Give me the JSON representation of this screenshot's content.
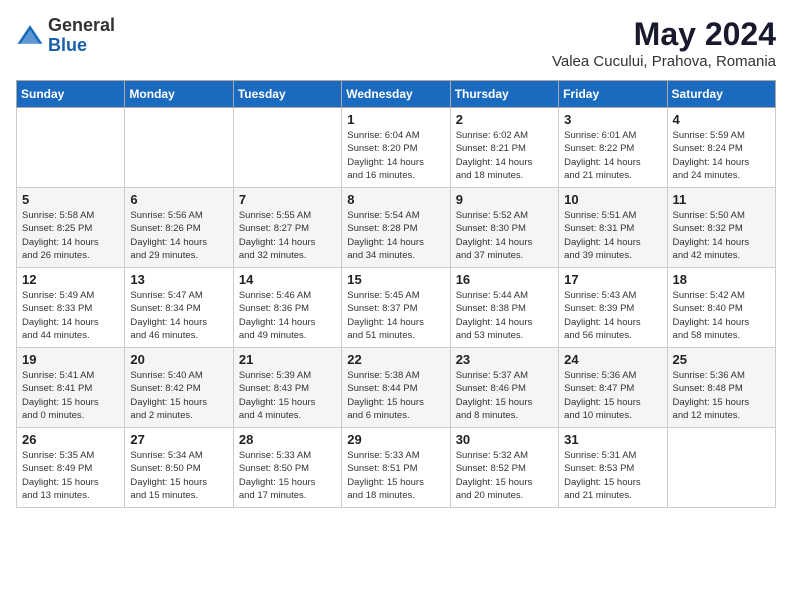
{
  "logo": {
    "general": "General",
    "blue": "Blue"
  },
  "title": "May 2024",
  "location": "Valea Cucului, Prahova, Romania",
  "days_of_week": [
    "Sunday",
    "Monday",
    "Tuesday",
    "Wednesday",
    "Thursday",
    "Friday",
    "Saturday"
  ],
  "weeks": [
    [
      {
        "day": "",
        "info": ""
      },
      {
        "day": "",
        "info": ""
      },
      {
        "day": "",
        "info": ""
      },
      {
        "day": "1",
        "info": "Sunrise: 6:04 AM\nSunset: 8:20 PM\nDaylight: 14 hours\nand 16 minutes."
      },
      {
        "day": "2",
        "info": "Sunrise: 6:02 AM\nSunset: 8:21 PM\nDaylight: 14 hours\nand 18 minutes."
      },
      {
        "day": "3",
        "info": "Sunrise: 6:01 AM\nSunset: 8:22 PM\nDaylight: 14 hours\nand 21 minutes."
      },
      {
        "day": "4",
        "info": "Sunrise: 5:59 AM\nSunset: 8:24 PM\nDaylight: 14 hours\nand 24 minutes."
      }
    ],
    [
      {
        "day": "5",
        "info": "Sunrise: 5:58 AM\nSunset: 8:25 PM\nDaylight: 14 hours\nand 26 minutes."
      },
      {
        "day": "6",
        "info": "Sunrise: 5:56 AM\nSunset: 8:26 PM\nDaylight: 14 hours\nand 29 minutes."
      },
      {
        "day": "7",
        "info": "Sunrise: 5:55 AM\nSunset: 8:27 PM\nDaylight: 14 hours\nand 32 minutes."
      },
      {
        "day": "8",
        "info": "Sunrise: 5:54 AM\nSunset: 8:28 PM\nDaylight: 14 hours\nand 34 minutes."
      },
      {
        "day": "9",
        "info": "Sunrise: 5:52 AM\nSunset: 8:30 PM\nDaylight: 14 hours\nand 37 minutes."
      },
      {
        "day": "10",
        "info": "Sunrise: 5:51 AM\nSunset: 8:31 PM\nDaylight: 14 hours\nand 39 minutes."
      },
      {
        "day": "11",
        "info": "Sunrise: 5:50 AM\nSunset: 8:32 PM\nDaylight: 14 hours\nand 42 minutes."
      }
    ],
    [
      {
        "day": "12",
        "info": "Sunrise: 5:49 AM\nSunset: 8:33 PM\nDaylight: 14 hours\nand 44 minutes."
      },
      {
        "day": "13",
        "info": "Sunrise: 5:47 AM\nSunset: 8:34 PM\nDaylight: 14 hours\nand 46 minutes."
      },
      {
        "day": "14",
        "info": "Sunrise: 5:46 AM\nSunset: 8:36 PM\nDaylight: 14 hours\nand 49 minutes."
      },
      {
        "day": "15",
        "info": "Sunrise: 5:45 AM\nSunset: 8:37 PM\nDaylight: 14 hours\nand 51 minutes."
      },
      {
        "day": "16",
        "info": "Sunrise: 5:44 AM\nSunset: 8:38 PM\nDaylight: 14 hours\nand 53 minutes."
      },
      {
        "day": "17",
        "info": "Sunrise: 5:43 AM\nSunset: 8:39 PM\nDaylight: 14 hours\nand 56 minutes."
      },
      {
        "day": "18",
        "info": "Sunrise: 5:42 AM\nSunset: 8:40 PM\nDaylight: 14 hours\nand 58 minutes."
      }
    ],
    [
      {
        "day": "19",
        "info": "Sunrise: 5:41 AM\nSunset: 8:41 PM\nDaylight: 15 hours\nand 0 minutes."
      },
      {
        "day": "20",
        "info": "Sunrise: 5:40 AM\nSunset: 8:42 PM\nDaylight: 15 hours\nand 2 minutes."
      },
      {
        "day": "21",
        "info": "Sunrise: 5:39 AM\nSunset: 8:43 PM\nDaylight: 15 hours\nand 4 minutes."
      },
      {
        "day": "22",
        "info": "Sunrise: 5:38 AM\nSunset: 8:44 PM\nDaylight: 15 hours\nand 6 minutes."
      },
      {
        "day": "23",
        "info": "Sunrise: 5:37 AM\nSunset: 8:46 PM\nDaylight: 15 hours\nand 8 minutes."
      },
      {
        "day": "24",
        "info": "Sunrise: 5:36 AM\nSunset: 8:47 PM\nDaylight: 15 hours\nand 10 minutes."
      },
      {
        "day": "25",
        "info": "Sunrise: 5:36 AM\nSunset: 8:48 PM\nDaylight: 15 hours\nand 12 minutes."
      }
    ],
    [
      {
        "day": "26",
        "info": "Sunrise: 5:35 AM\nSunset: 8:49 PM\nDaylight: 15 hours\nand 13 minutes."
      },
      {
        "day": "27",
        "info": "Sunrise: 5:34 AM\nSunset: 8:50 PM\nDaylight: 15 hours\nand 15 minutes."
      },
      {
        "day": "28",
        "info": "Sunrise: 5:33 AM\nSunset: 8:50 PM\nDaylight: 15 hours\nand 17 minutes."
      },
      {
        "day": "29",
        "info": "Sunrise: 5:33 AM\nSunset: 8:51 PM\nDaylight: 15 hours\nand 18 minutes."
      },
      {
        "day": "30",
        "info": "Sunrise: 5:32 AM\nSunset: 8:52 PM\nDaylight: 15 hours\nand 20 minutes."
      },
      {
        "day": "31",
        "info": "Sunrise: 5:31 AM\nSunset: 8:53 PM\nDaylight: 15 hours\nand 21 minutes."
      },
      {
        "day": "",
        "info": ""
      }
    ]
  ]
}
